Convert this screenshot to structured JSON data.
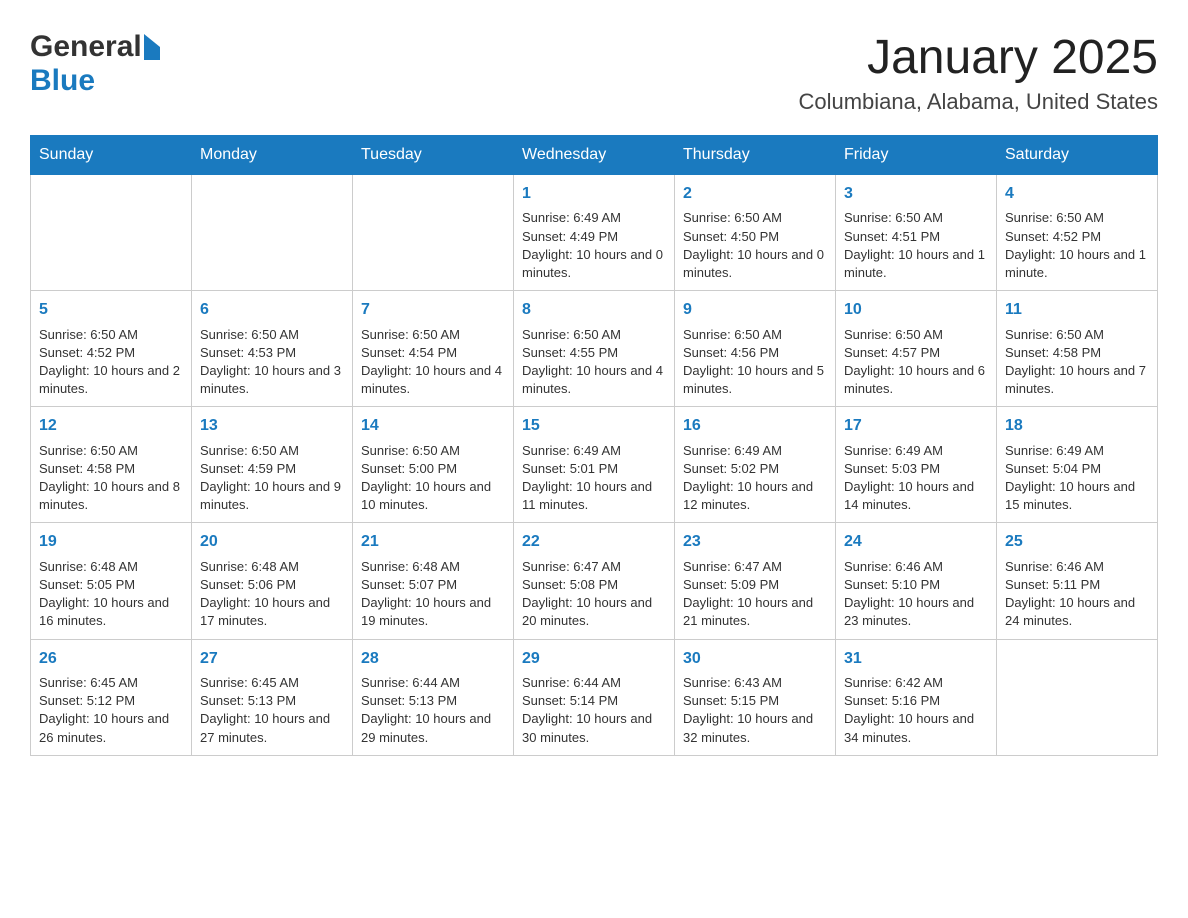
{
  "header": {
    "logo_general": "General",
    "logo_blue": "Blue",
    "month_title": "January 2025",
    "location": "Columbiana, Alabama, United States"
  },
  "weekdays": [
    "Sunday",
    "Monday",
    "Tuesday",
    "Wednesday",
    "Thursday",
    "Friday",
    "Saturday"
  ],
  "weeks": [
    [
      {
        "day": "",
        "info": ""
      },
      {
        "day": "",
        "info": ""
      },
      {
        "day": "",
        "info": ""
      },
      {
        "day": "1",
        "info": "Sunrise: 6:49 AM\nSunset: 4:49 PM\nDaylight: 10 hours and 0 minutes."
      },
      {
        "day": "2",
        "info": "Sunrise: 6:50 AM\nSunset: 4:50 PM\nDaylight: 10 hours and 0 minutes."
      },
      {
        "day": "3",
        "info": "Sunrise: 6:50 AM\nSunset: 4:51 PM\nDaylight: 10 hours and 1 minute."
      },
      {
        "day": "4",
        "info": "Sunrise: 6:50 AM\nSunset: 4:52 PM\nDaylight: 10 hours and 1 minute."
      }
    ],
    [
      {
        "day": "5",
        "info": "Sunrise: 6:50 AM\nSunset: 4:52 PM\nDaylight: 10 hours and 2 minutes."
      },
      {
        "day": "6",
        "info": "Sunrise: 6:50 AM\nSunset: 4:53 PM\nDaylight: 10 hours and 3 minutes."
      },
      {
        "day": "7",
        "info": "Sunrise: 6:50 AM\nSunset: 4:54 PM\nDaylight: 10 hours and 4 minutes."
      },
      {
        "day": "8",
        "info": "Sunrise: 6:50 AM\nSunset: 4:55 PM\nDaylight: 10 hours and 4 minutes."
      },
      {
        "day": "9",
        "info": "Sunrise: 6:50 AM\nSunset: 4:56 PM\nDaylight: 10 hours and 5 minutes."
      },
      {
        "day": "10",
        "info": "Sunrise: 6:50 AM\nSunset: 4:57 PM\nDaylight: 10 hours and 6 minutes."
      },
      {
        "day": "11",
        "info": "Sunrise: 6:50 AM\nSunset: 4:58 PM\nDaylight: 10 hours and 7 minutes."
      }
    ],
    [
      {
        "day": "12",
        "info": "Sunrise: 6:50 AM\nSunset: 4:58 PM\nDaylight: 10 hours and 8 minutes."
      },
      {
        "day": "13",
        "info": "Sunrise: 6:50 AM\nSunset: 4:59 PM\nDaylight: 10 hours and 9 minutes."
      },
      {
        "day": "14",
        "info": "Sunrise: 6:50 AM\nSunset: 5:00 PM\nDaylight: 10 hours and 10 minutes."
      },
      {
        "day": "15",
        "info": "Sunrise: 6:49 AM\nSunset: 5:01 PM\nDaylight: 10 hours and 11 minutes."
      },
      {
        "day": "16",
        "info": "Sunrise: 6:49 AM\nSunset: 5:02 PM\nDaylight: 10 hours and 12 minutes."
      },
      {
        "day": "17",
        "info": "Sunrise: 6:49 AM\nSunset: 5:03 PM\nDaylight: 10 hours and 14 minutes."
      },
      {
        "day": "18",
        "info": "Sunrise: 6:49 AM\nSunset: 5:04 PM\nDaylight: 10 hours and 15 minutes."
      }
    ],
    [
      {
        "day": "19",
        "info": "Sunrise: 6:48 AM\nSunset: 5:05 PM\nDaylight: 10 hours and 16 minutes."
      },
      {
        "day": "20",
        "info": "Sunrise: 6:48 AM\nSunset: 5:06 PM\nDaylight: 10 hours and 17 minutes."
      },
      {
        "day": "21",
        "info": "Sunrise: 6:48 AM\nSunset: 5:07 PM\nDaylight: 10 hours and 19 minutes."
      },
      {
        "day": "22",
        "info": "Sunrise: 6:47 AM\nSunset: 5:08 PM\nDaylight: 10 hours and 20 minutes."
      },
      {
        "day": "23",
        "info": "Sunrise: 6:47 AM\nSunset: 5:09 PM\nDaylight: 10 hours and 21 minutes."
      },
      {
        "day": "24",
        "info": "Sunrise: 6:46 AM\nSunset: 5:10 PM\nDaylight: 10 hours and 23 minutes."
      },
      {
        "day": "25",
        "info": "Sunrise: 6:46 AM\nSunset: 5:11 PM\nDaylight: 10 hours and 24 minutes."
      }
    ],
    [
      {
        "day": "26",
        "info": "Sunrise: 6:45 AM\nSunset: 5:12 PM\nDaylight: 10 hours and 26 minutes."
      },
      {
        "day": "27",
        "info": "Sunrise: 6:45 AM\nSunset: 5:13 PM\nDaylight: 10 hours and 27 minutes."
      },
      {
        "day": "28",
        "info": "Sunrise: 6:44 AM\nSunset: 5:13 PM\nDaylight: 10 hours and 29 minutes."
      },
      {
        "day": "29",
        "info": "Sunrise: 6:44 AM\nSunset: 5:14 PM\nDaylight: 10 hours and 30 minutes."
      },
      {
        "day": "30",
        "info": "Sunrise: 6:43 AM\nSunset: 5:15 PM\nDaylight: 10 hours and 32 minutes."
      },
      {
        "day": "31",
        "info": "Sunrise: 6:42 AM\nSunset: 5:16 PM\nDaylight: 10 hours and 34 minutes."
      },
      {
        "day": "",
        "info": ""
      }
    ]
  ]
}
